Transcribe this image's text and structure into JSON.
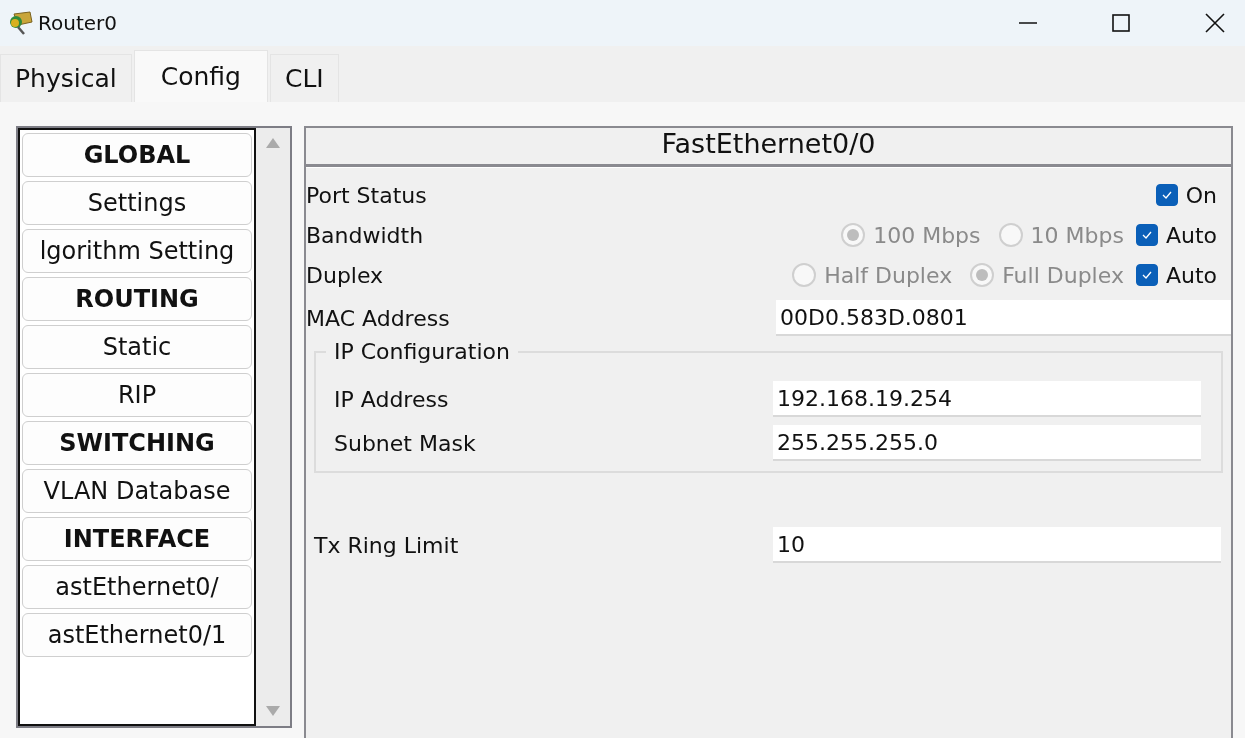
{
  "window": {
    "title": "Router0"
  },
  "tabs": [
    {
      "label": "Physical",
      "selected": false
    },
    {
      "label": "Config",
      "selected": true
    },
    {
      "label": "CLI",
      "selected": false
    }
  ],
  "sidebar": {
    "items": [
      {
        "label": "GLOBAL",
        "kind": "header"
      },
      {
        "label": "Settings",
        "kind": "item"
      },
      {
        "label": "lgorithm Setting",
        "kind": "item"
      },
      {
        "label": "ROUTING",
        "kind": "header"
      },
      {
        "label": "Static",
        "kind": "item"
      },
      {
        "label": "RIP",
        "kind": "item"
      },
      {
        "label": "SWITCHING",
        "kind": "header"
      },
      {
        "label": "VLAN Database",
        "kind": "item"
      },
      {
        "label": "INTERFACE",
        "kind": "header"
      },
      {
        "label": "astEthernet0/",
        "kind": "item"
      },
      {
        "label": "astEthernet0/1",
        "kind": "item"
      }
    ]
  },
  "panel": {
    "title": "FastEthernet0/0",
    "rows": [
      {
        "kind": "toggle",
        "label": "Port Status",
        "checkbox": {
          "label": "On",
          "checked": true
        }
      },
      {
        "kind": "choice",
        "label": "Bandwidth",
        "options": [
          {
            "label": "100 Mbps",
            "selected": true,
            "disabled": true
          },
          {
            "label": "10 Mbps",
            "selected": false,
            "disabled": true
          }
        ],
        "auto": {
          "label": "Auto",
          "checked": true
        }
      },
      {
        "kind": "choice",
        "label": "Duplex",
        "options": [
          {
            "label": "Half Duplex",
            "selected": false,
            "disabled": true
          },
          {
            "label": "Full Duplex",
            "selected": true,
            "disabled": true
          }
        ],
        "auto": {
          "label": "Auto",
          "checked": true
        }
      },
      {
        "kind": "field",
        "label": "MAC Address",
        "value": "00D0.583D.0801"
      }
    ],
    "ip_configuration": {
      "legend": "IP Configuration",
      "fields": [
        {
          "label": "IP Address",
          "value": "192.168.19.254"
        },
        {
          "label": "Subnet Mask",
          "value": "255.255.255.0"
        }
      ]
    },
    "tx_ring_limit": {
      "label": "Tx Ring Limit",
      "value": "10"
    }
  }
}
